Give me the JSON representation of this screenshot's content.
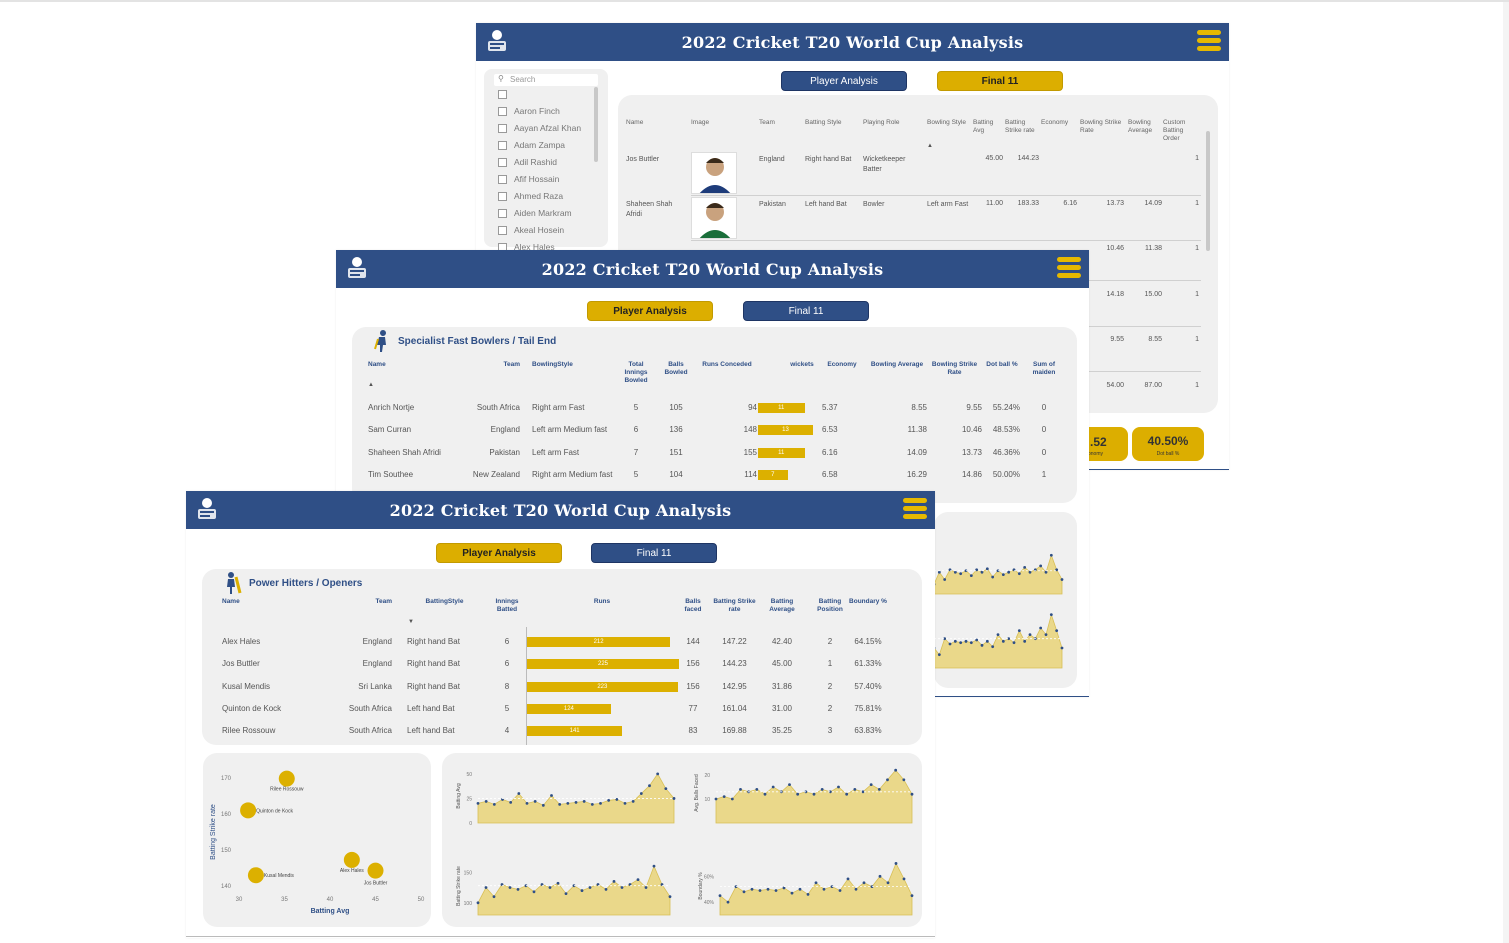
{
  "dashboard": {
    "title": "2022 Cricket T20 World Cup Analysis",
    "nav_player": "Player Analysis",
    "nav_final": "Final 11"
  },
  "final11": {
    "search_placeholder": "Search",
    "slicer_items": [
      "Aaron Finch",
      "Aayan Afzal Khan",
      "Adam Zampa",
      "Adil Rashid",
      "Afif Hossain",
      "Ahmed Raza",
      "Aiden Markram",
      "Akeal Hosein",
      "Alex Hales"
    ],
    "columns": [
      "Name",
      "Image",
      "Team",
      "Batting Style",
      "Playing Role",
      "Bowling Style",
      "Batting Avg",
      "Batting Strike rate",
      "Economy",
      "Bowling Strike Rate",
      "Bowling Average",
      "Custom Batting Order"
    ],
    "rows": [
      {
        "name": "Jos Buttler",
        "team": "England",
        "batting_style": "Right hand Bat",
        "role": "Wicketkeeper Batter",
        "bowling_style": "",
        "bat_avg": "45.00",
        "bat_sr": "144.23",
        "economy": "",
        "bowl_sr": "",
        "bowl_avg": "",
        "order": "1"
      },
      {
        "name": "Shaheen Shah Afridi",
        "team": "Pakistan",
        "batting_style": "Left hand Bat",
        "role": "Bowler",
        "bowling_style": "Left arm Fast",
        "bat_avg": "11.00",
        "bat_sr": "183.33",
        "economy": "6.16",
        "bowl_sr": "13.73",
        "bowl_avg": "14.09",
        "order": "1"
      }
    ],
    "extra_rows": [
      {
        "bowl_sr": "10.46",
        "bowl_avg": "11.38",
        "order": "1"
      },
      {
        "bowl_sr": "14.18",
        "bowl_avg": "15.00",
        "order": "1"
      },
      {
        "bowl_sr": "9.55",
        "bowl_avg": "8.55",
        "order": "1"
      },
      {
        "bowl_sr": "54.00",
        "bowl_avg": "87.00",
        "order": "1"
      }
    ],
    "kpi_partial_value": ".52",
    "kpi_partial_label": "onomy",
    "kpi_value": "40.50%",
    "kpi_label": "Dot ball %"
  },
  "bowlers": {
    "title": "Specialist Fast Bowlers / Tail End",
    "columns": [
      "Name",
      "Team",
      "BowlingStyle",
      "Total Innings Bowled",
      "Balls Bowled",
      "Runs Conceded",
      "wickets",
      "Economy",
      "Bowling Average",
      "Bowling Strike Rate",
      "Dot ball %",
      "Sum of maiden"
    ],
    "rows": [
      {
        "name": "Anrich Nortje",
        "team": "South Africa",
        "style": "Right arm Fast",
        "innings": "5",
        "balls": "105",
        "runs": "94",
        "wickets": 11,
        "wickets_label": "11",
        "economy": "5.37",
        "avg": "8.55",
        "sr": "9.55",
        "dot": "55.24%",
        "maiden": "0"
      },
      {
        "name": "Sam Curran",
        "team": "England",
        "style": "Left arm Medium fast",
        "innings": "6",
        "balls": "136",
        "runs": "148",
        "wickets": 13,
        "wickets_label": "13",
        "economy": "6.53",
        "avg": "11.38",
        "sr": "10.46",
        "dot": "48.53%",
        "maiden": "0"
      },
      {
        "name": "Shaheen Shah Afridi",
        "team": "Pakistan",
        "style": "Left arm Fast",
        "innings": "7",
        "balls": "151",
        "runs": "155",
        "wickets": 11,
        "wickets_label": "11",
        "economy": "6.16",
        "avg": "14.09",
        "sr": "13.73",
        "dot": "46.36%",
        "maiden": "0"
      },
      {
        "name": "Tim Southee",
        "team": "New Zealand",
        "style": "Right arm Medium fast",
        "innings": "5",
        "balls": "104",
        "runs": "114",
        "wickets": 7,
        "wickets_label": "7",
        "economy": "6.58",
        "avg": "16.29",
        "sr": "14.86",
        "dot": "50.00%",
        "maiden": "1"
      }
    ],
    "wickets_max": 13
  },
  "openers": {
    "title": "Power Hitters / Openers",
    "columns": [
      "Name",
      "Team",
      "BattingStyle",
      "Innings Batted",
      "Runs",
      "Balls faced",
      "Batting Strike rate",
      "Batting Average",
      "Batting Position",
      "Boundary %"
    ],
    "rows": [
      {
        "name": "Alex Hales",
        "team": "England",
        "style": "Right hand Bat",
        "innings": "6",
        "runs": 212,
        "runs_label": "212",
        "balls": "144",
        "sr": "147.22",
        "avg": "42.40",
        "pos": "2",
        "boundary": "64.15%"
      },
      {
        "name": "Jos Buttler",
        "team": "England",
        "style": "Right hand Bat",
        "innings": "6",
        "runs": 225,
        "runs_label": "225",
        "balls": "156",
        "sr": "144.23",
        "avg": "45.00",
        "pos": "1",
        "boundary": "61.33%"
      },
      {
        "name": "Kusal Mendis",
        "team": "Sri Lanka",
        "style": "Right hand Bat",
        "innings": "8",
        "runs": 223,
        "runs_label": "223",
        "balls": "156",
        "sr": "142.95",
        "avg": "31.86",
        "pos": "2",
        "boundary": "57.40%"
      },
      {
        "name": "Quinton de Kock",
        "team": "South Africa",
        "style": "Left hand Bat",
        "innings": "5",
        "runs": 124,
        "runs_label": "124",
        "balls": "77",
        "sr": "161.04",
        "avg": "31.00",
        "pos": "2",
        "boundary": "75.81%"
      },
      {
        "name": "Rilee Rossouw",
        "team": "South Africa",
        "style": "Left hand Bat",
        "innings": "4",
        "runs": 141,
        "runs_label": "141",
        "balls": "83",
        "sr": "169.88",
        "avg": "35.25",
        "pos": "3",
        "boundary": "63.83%"
      }
    ],
    "runs_max": 225
  },
  "chart_data": [
    {
      "type": "scatter",
      "xlabel": "Batting Avg",
      "ylabel": "Batting Strike rate",
      "xlim": [
        30,
        50
      ],
      "ylim": [
        138,
        172
      ],
      "xticks": [
        "30",
        "35",
        "40",
        "45",
        "50"
      ],
      "yticks": [
        "140",
        "150",
        "160",
        "170"
      ],
      "points": [
        {
          "label": "Rilee Rossouw",
          "x": 35.25,
          "y": 169.88
        },
        {
          "label": "Quinton de Kock",
          "x": 31.0,
          "y": 161.04
        },
        {
          "label": "Kusal Mendis",
          "x": 31.86,
          "y": 142.95
        },
        {
          "label": "Alex Hales",
          "x": 42.4,
          "y": 147.22
        },
        {
          "label": "Jos Buttler",
          "x": 45.0,
          "y": 144.23
        }
      ]
    },
    {
      "type": "area",
      "ylabel": "Batting Avg",
      "yticks": [
        "0",
        "25",
        "50"
      ],
      "ylim": [
        0,
        55
      ],
      "values": [
        20,
        22,
        19,
        24,
        21,
        30,
        20,
        22,
        18,
        28,
        19,
        20,
        21,
        22,
        19,
        20,
        23,
        24,
        20,
        22,
        30,
        38,
        50,
        35,
        25
      ],
      "mean": 25
    },
    {
      "type": "area",
      "ylabel": "Avg. Balls Faced",
      "yticks": [
        "10",
        "20"
      ],
      "ylim": [
        0,
        25
      ],
      "values": [
        10,
        11,
        10,
        14,
        13,
        14,
        12,
        15,
        13,
        16,
        12,
        13,
        12,
        14,
        13,
        15,
        12,
        14,
        13,
        16,
        14,
        18,
        22,
        18,
        12
      ],
      "mean": 13
    },
    {
      "type": "area",
      "ylabel": "Batting Strike rate",
      "yticks": [
        "100",
        "150"
      ],
      "ylim": [
        80,
        175
      ],
      "values": [
        100,
        125,
        110,
        130,
        125,
        122,
        128,
        118,
        130,
        125,
        132,
        115,
        128,
        120,
        125,
        130,
        122,
        135,
        125,
        130,
        138,
        125,
        160,
        130,
        110
      ],
      "mean": 128
    },
    {
      "type": "area",
      "ylabel": "Boundary %",
      "yticks": [
        "40%",
        "60%"
      ],
      "ylim": [
        30,
        75
      ],
      "values": [
        45,
        40,
        52,
        48,
        50,
        49,
        50,
        49,
        51,
        47,
        50,
        46,
        55,
        50,
        52,
        49,
        58,
        50,
        55,
        52,
        60,
        55,
        70,
        58,
        45
      ],
      "mean": 52
    }
  ]
}
